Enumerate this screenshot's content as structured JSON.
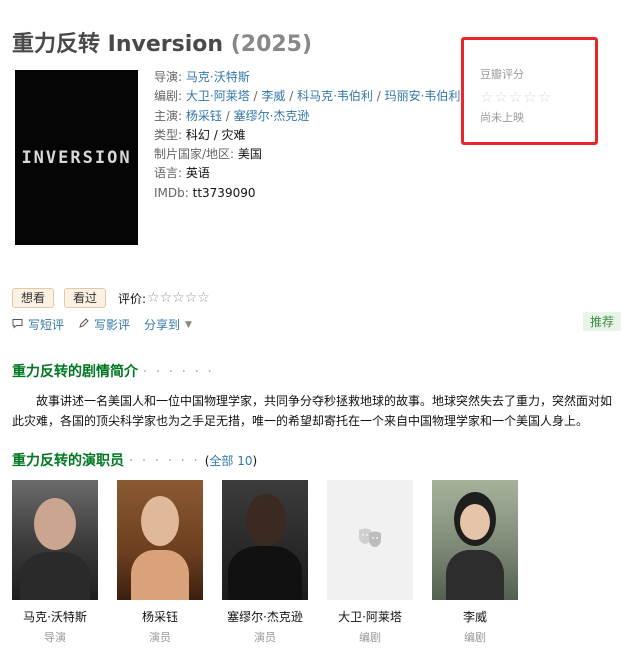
{
  "movie": {
    "title": "重力反转 Inversion",
    "year": "(2025)",
    "poster_text": "INVERSION"
  },
  "info": {
    "director_label": "导演:",
    "director": "马克·沃特斯",
    "writers_label": "编剧:",
    "writers": [
      "大卫·阿莱塔",
      "李威",
      "科马克·韦伯利",
      "玛丽安·韦伯利"
    ],
    "cast_label": "主演:",
    "cast": [
      "杨采钰",
      "塞缪尔·杰克逊"
    ],
    "genre_label": "类型:",
    "genre": "科幻 / 灾难",
    "country_label": "制片国家/地区:",
    "country": "美国",
    "language_label": "语言:",
    "language": "英语",
    "imdb_label": "IMDb:",
    "imdb": "tt3739090",
    "sep": " / "
  },
  "rating": {
    "title": "豆瓣评分",
    "status": "尚未上映",
    "star_icon": "☆",
    "stars": 5
  },
  "actions": {
    "want": "想看",
    "watched": "看过",
    "rate_label": "评价:",
    "rate_stars": "☆☆☆☆☆"
  },
  "links": {
    "short_review": "写短评",
    "review": "写影评",
    "share": "分享到",
    "recommend": "推荐"
  },
  "summary": {
    "title": "重力反转的剧情简介",
    "dots": "· · · · · ·",
    "text": "故事讲述一名美国人和一位中国物理学家，共同争分夺秒拯救地球的故事。地球突然失去了重力，突然面对如此灾难，各国的顶尖科学家也为之手足无措，唯一的希望却寄托在一个来自中国物理学家和一个美国人身上。"
  },
  "cast_section": {
    "title": "重力反转的演职员",
    "dots": "· · · · · ·",
    "open": "(",
    "all": "全部 10",
    "close": ")",
    "members": [
      {
        "name": "马克·沃特斯",
        "role": "导演"
      },
      {
        "name": "杨采钰",
        "role": "演员"
      },
      {
        "name": "塞缪尔·杰克逊",
        "role": "演员"
      },
      {
        "name": "大卫·阿莱塔",
        "role": "编剧"
      },
      {
        "name": "李威",
        "role": "编剧"
      }
    ]
  },
  "colors": {
    "link": "#3377aa",
    "section_green": "#007722",
    "highlight_border": "#e8262c"
  }
}
